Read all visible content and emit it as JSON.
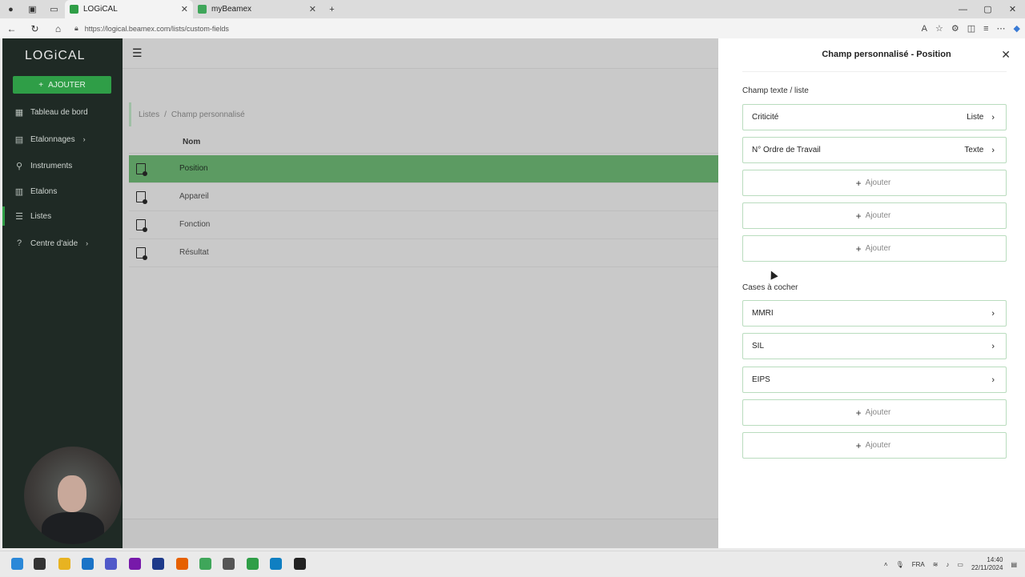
{
  "browser": {
    "tabs": [
      {
        "label": "LOGiCAL",
        "active": true
      },
      {
        "label": "myBeamex",
        "active": false
      }
    ],
    "url": "https://logical.beamex.com/lists/custom-fields"
  },
  "sidebar": {
    "logo": "LOGiCAL",
    "add_button": "AJOUTER",
    "items": [
      {
        "label": "Tableau de bord",
        "icon": "dashboard-icon"
      },
      {
        "label": "Etalonnages",
        "icon": "calibration-icon",
        "has_children": true
      },
      {
        "label": "Instruments",
        "icon": "instrument-icon"
      },
      {
        "label": "Etalons",
        "icon": "reference-icon"
      },
      {
        "label": "Listes",
        "icon": "list-icon",
        "active": true
      },
      {
        "label": "Centre d'aide",
        "icon": "help-icon",
        "has_children": true
      }
    ]
  },
  "main": {
    "breadcrumb": [
      "Listes",
      "/",
      "Champ personnalisé"
    ],
    "column_header": "Nom",
    "rows": [
      {
        "label": "Position",
        "selected": true
      },
      {
        "label": "Appareil"
      },
      {
        "label": "Fonction"
      },
      {
        "label": "Résultat"
      }
    ]
  },
  "panel": {
    "title": "Champ personnalisé - Position",
    "text_section_title": "Champ texte / liste",
    "text_fields": [
      {
        "name": "Criticité",
        "type": "Liste"
      },
      {
        "name": "N° Ordre de Travail",
        "type": "Texte"
      }
    ],
    "add_label": "Ajouter",
    "checkbox_section_title": "Cases à cocher",
    "checkbox_fields": [
      {
        "name": "MMRI"
      },
      {
        "name": "SIL"
      },
      {
        "name": "EIPS"
      }
    ]
  },
  "taskbar": {
    "language": "FRA",
    "time": "14:40",
    "date": "22/11/2024"
  },
  "colors": {
    "accent": "#2f9e47",
    "sidebar_bg": "#1f2a25",
    "selected_row": "#5c9b62"
  }
}
